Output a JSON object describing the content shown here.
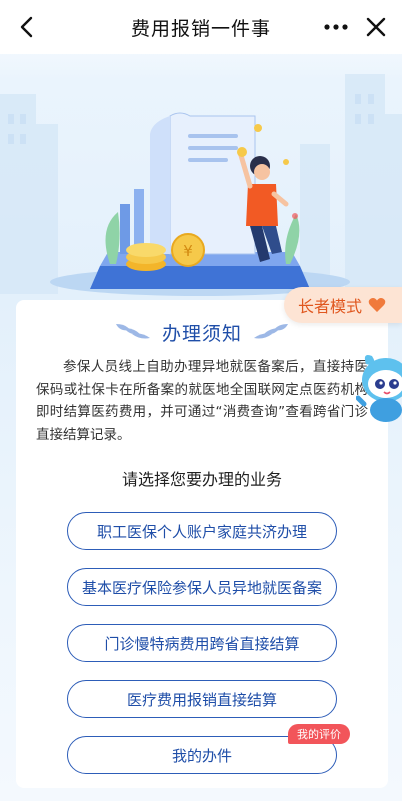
{
  "navbar": {
    "title": "费用报销一件事",
    "back_icon": "chevron-left-icon",
    "more_icon": "more-dots-icon",
    "close_icon": "close-icon"
  },
  "elder_mode": {
    "label": "长者模式",
    "icon": "heart-icon",
    "accent": "#e0571f"
  },
  "notice": {
    "title": "办理须知",
    "text": "参保人员线上自助办理异地就医备案后，直接持医保码或社保卡在所备案的就医地全国联网定点医药机构即时结算医药费用，并可通过“消费查询”查看跨省门诊直接结算记录。"
  },
  "services": {
    "heading": "请选择您要办理的业务",
    "items": [
      {
        "label": "职工医保个人账户家庭共济办理"
      },
      {
        "label": "基本医疗保险参保人员异地就医备案"
      },
      {
        "label": "门诊慢特病费用跨省直接结算"
      },
      {
        "label": "医疗费用报销直接结算"
      },
      {
        "label": "我的办件"
      }
    ],
    "review_badge": "我的评价"
  },
  "colors": {
    "primary": "#1f4ea8",
    "badge": "#f2555a",
    "elder_bg": "#fde4d4"
  }
}
